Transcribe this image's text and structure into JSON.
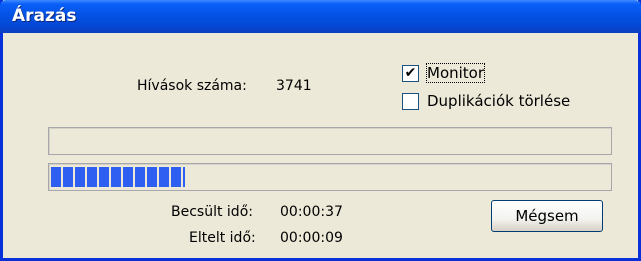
{
  "window": {
    "title": "Árazás"
  },
  "calls": {
    "label": "Hívások száma:",
    "value": "3741"
  },
  "options": {
    "monitor": {
      "label": "Monitor",
      "checked": true,
      "mark": "✔"
    },
    "dedup": {
      "label": "Duplikációk törlése",
      "checked": false
    }
  },
  "progress": {
    "top_fill": 0,
    "bottom_fill": 0.24
  },
  "times": {
    "estimated_label": "Becsült idő:",
    "estimated_value": "00:00:37",
    "elapsed_label": "Eltelt idő:",
    "elapsed_value": "00:00:09"
  },
  "cancel_button": {
    "label": "Mégsem"
  }
}
